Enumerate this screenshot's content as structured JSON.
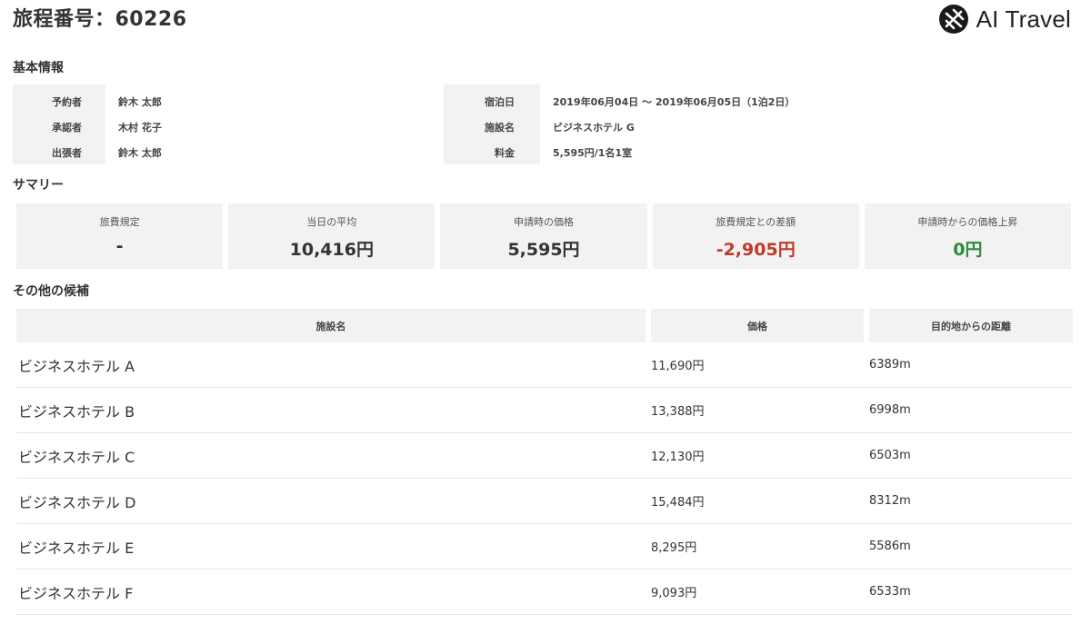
{
  "header": {
    "title": "旅程番号：60226",
    "logo_text": "AI Travel"
  },
  "basic_info": {
    "section_title": "基本情報",
    "left": [
      {
        "label": "予約者",
        "value": "鈴木 太郎"
      },
      {
        "label": "承認者",
        "value": "木村 花子"
      },
      {
        "label": "出張者",
        "value": "鈴木 太郎"
      }
    ],
    "right": [
      {
        "label": "宿泊日",
        "value": "2019年06月04日 〜 2019年06月05日（1泊2日）"
      },
      {
        "label": "施設名",
        "value": "ビジネスホテル G"
      },
      {
        "label": "料金",
        "value": "5,595円/1名1室"
      }
    ]
  },
  "summary": {
    "section_title": "サマリー",
    "cards": [
      {
        "label": "旅費規定",
        "value": "-",
        "tone": "normal"
      },
      {
        "label": "当日の平均",
        "value": "10,416円",
        "tone": "normal"
      },
      {
        "label": "申請時の価格",
        "value": "5,595円",
        "tone": "normal"
      },
      {
        "label": "旅費規定との差額",
        "value": "-2,905円",
        "tone": "red"
      },
      {
        "label": "申請時からの価格上昇",
        "value": "0円",
        "tone": "green"
      }
    ],
    "colors": {
      "red": "#c0392b",
      "green": "#2e8b3d"
    }
  },
  "candidates": {
    "section_title": "その他の候補",
    "columns": [
      "施設名",
      "価格",
      "目的地からの距離"
    ],
    "rows": [
      {
        "name": "ビジネスホテル A",
        "price": "11,690円",
        "distance": "6389m"
      },
      {
        "name": "ビジネスホテル B",
        "price": "13,388円",
        "distance": "6998m"
      },
      {
        "name": "ビジネスホテル C",
        "price": "12,130円",
        "distance": "6503m"
      },
      {
        "name": "ビジネスホテル D",
        "price": "15,484円",
        "distance": "8312m"
      },
      {
        "name": "ビジネスホテル E",
        "price": "8,295円",
        "distance": "5586m"
      },
      {
        "name": "ビジネスホテル F",
        "price": "9,093円",
        "distance": "6533m"
      }
    ]
  }
}
